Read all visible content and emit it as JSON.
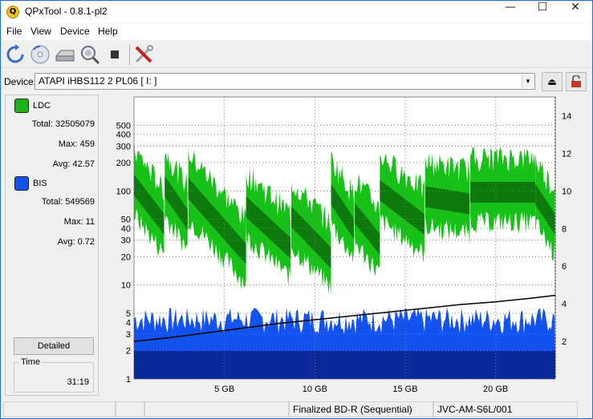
{
  "window": {
    "title": "QPxTool - 0.8.1-pl2",
    "app_icon_letter": "Q",
    "minimize": "—",
    "maximize": "☐",
    "close": "✕"
  },
  "menu": [
    "File",
    "View",
    "Device",
    "Help"
  ],
  "toolbar": {
    "icons": [
      "refresh-icon",
      "disc-icon",
      "drive-icon",
      "scan-magnifier-icon",
      "stop-icon",
      "settings-tools-icon"
    ]
  },
  "device": {
    "label": "Device:",
    "selected": "ATAPI   iHBS112   2    PL06 [ I: ]",
    "eject_icon": "⏏",
    "lock_icon": "🔒"
  },
  "legend": {
    "ldc": {
      "name": "LDC",
      "color": "#1db21d",
      "total_label": "Total:",
      "total": "32505079",
      "max_label": "Max:",
      "max": "459",
      "avg_label": "Avg:",
      "avg": "42.57"
    },
    "bis": {
      "name": "BIS",
      "color": "#1452f0",
      "total_label": "Total:",
      "total": "549569",
      "max_label": "Max:",
      "max": "11",
      "avg_label": "Avg:",
      "avg": "0.72"
    }
  },
  "detailed_button": "Detailed",
  "time": {
    "label": "Time",
    "value": "31:19"
  },
  "status": {
    "cell1": "",
    "cell2": "",
    "cell3": "",
    "disc_type": "Finalized BD-R (Sequential)",
    "media_id": "JVC-AM-S6L/001"
  },
  "chart_data": {
    "type": "area",
    "x_tick_labels": [
      "5 GB",
      "10 GB",
      "15 GB",
      "20 GB"
    ],
    "x_ticks_gb": [
      5,
      10,
      15,
      20
    ],
    "x_range_gb": [
      0,
      23.3
    ],
    "left_axis_labels": [
      "500",
      "400",
      "300",
      "200",
      "100",
      "50",
      "40",
      "30",
      "20",
      "10",
      "5",
      "4",
      "3",
      "2",
      "1"
    ],
    "left_axis_values": [
      500,
      400,
      300,
      200,
      100,
      50,
      40,
      30,
      20,
      10,
      5,
      4,
      3,
      2,
      1
    ],
    "right_axis_labels": [
      "14",
      "12",
      "10",
      "8",
      "6",
      "4",
      "2"
    ],
    "right_axis_values": [
      14,
      12,
      10,
      8,
      6,
      4,
      2
    ],
    "scale": "log (left)",
    "grid": true,
    "series": [
      {
        "name": "LDC",
        "color": "#17c117",
        "segments_gb": [
          [
            0,
            1.7
          ],
          [
            1.7,
            3.0
          ],
          [
            3.0,
            6.2
          ],
          [
            6.2,
            8.7
          ],
          [
            8.7,
            10.9
          ],
          [
            10.9,
            12.2
          ],
          [
            12.2,
            13.6
          ],
          [
            13.6,
            16.1
          ],
          [
            16.1,
            18.6
          ],
          [
            18.6,
            22.2
          ],
          [
            22.2,
            23.3
          ]
        ],
        "segment_avg_start": [
          120,
          115,
          110,
          70,
          55,
          95,
          60,
          105,
          90,
          100,
          95
        ],
        "segment_avg_end": [
          45,
          50,
          22,
          25,
          20,
          40,
          28,
          45,
          75,
          100,
          45
        ]
      },
      {
        "name": "BIS",
        "color": "#1452f0",
        "band_typical_max": 5,
        "max": 11
      },
      {
        "name": "speed",
        "color": "#000000",
        "x_gb": [
          0,
          2,
          4,
          6,
          8,
          10,
          12,
          14,
          16,
          18,
          20,
          22,
          23.3
        ],
        "y_right_axis": [
          2.0,
          2.2,
          2.45,
          2.7,
          2.95,
          3.15,
          3.35,
          3.55,
          3.75,
          3.95,
          4.1,
          4.3,
          4.45
        ]
      }
    ]
  }
}
